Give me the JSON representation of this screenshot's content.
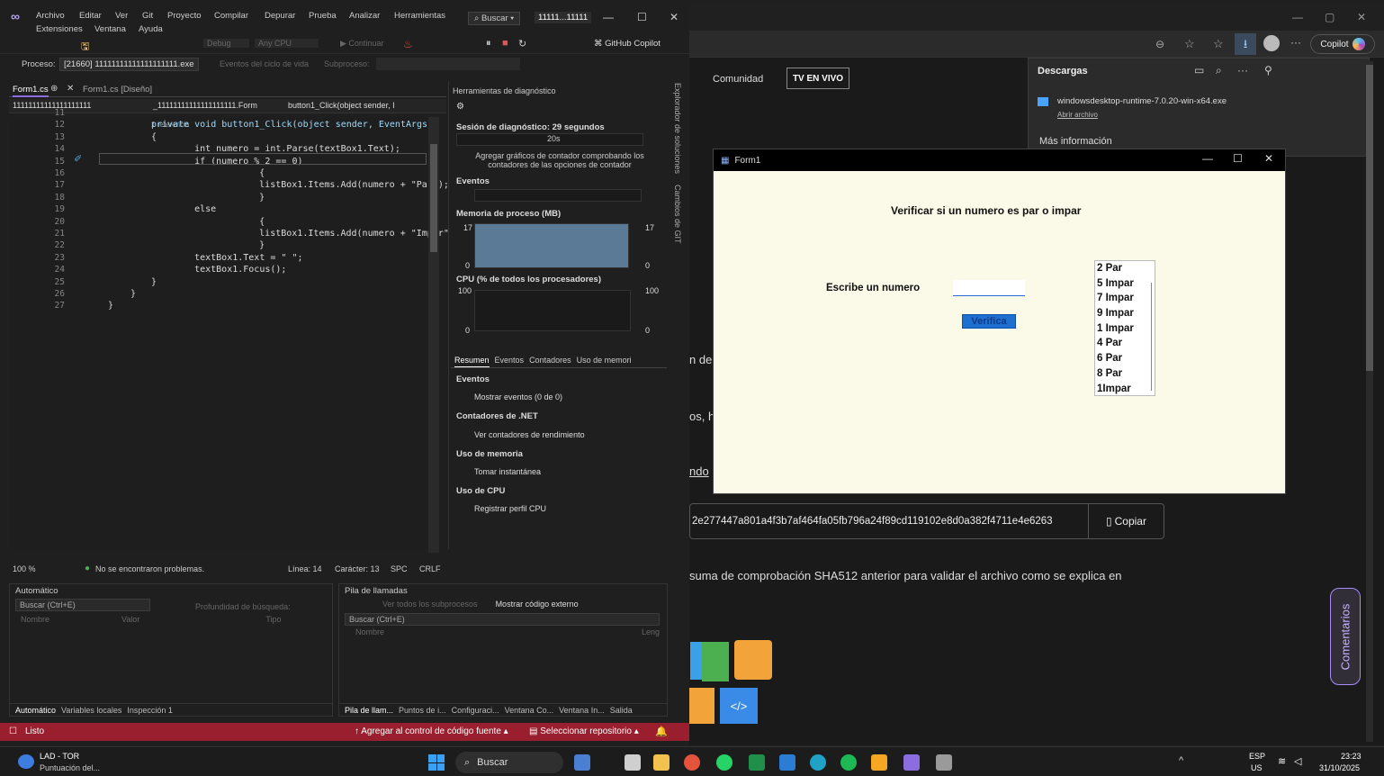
{
  "vs": {
    "menu": [
      "Archivo",
      "Editar",
      "Ver",
      "Git",
      "Proyecto",
      "Compilar",
      "Depurar",
      "Prueba",
      "Analizar",
      "Herramientas",
      "Extensiones",
      "Ventana",
      "Ayuda"
    ],
    "search": "Buscar",
    "project_title": "11111...11111",
    "toolbar": {
      "config": "Debug",
      "platform": "Any CPU",
      "continue": "Continuar",
      "copilot": "GitHub Copilot"
    },
    "proc": {
      "label": "Proceso:",
      "value": "[21660] 11111111111111111111.exe",
      "lifecycle": "Eventos del ciclo de vida",
      "thread": "Subproceso:"
    },
    "tabs": [
      "Form1.cs",
      "Form1.cs [Diseño]"
    ],
    "nav": {
      "left": "11111111111111111111",
      "mid": "_11111111111111111111.Form",
      "right": "button1_Click(object sender, I"
    },
    "refs": "1 referencia",
    "code_lines": [
      {
        "n": "11",
        "t": ""
      },
      {
        "n": "12",
        "t": "private void button1_Click(object sender, EventArgs"
      },
      {
        "n": "13",
        "t": "{"
      },
      {
        "n": "14",
        "t": "    int numero = int.Parse(textBox1.Text);"
      },
      {
        "n": "15",
        "t": "    if (numero % 2 == 0)"
      },
      {
        "n": "16",
        "t": "        {"
      },
      {
        "n": "17",
        "t": "        listBox1.Items.Add(numero + \"Par\");"
      },
      {
        "n": "18",
        "t": "        }"
      },
      {
        "n": "19",
        "t": "    else"
      },
      {
        "n": "20",
        "t": "        {"
      },
      {
        "n": "21",
        "t": "        listBox1.Items.Add(numero + \"Impar\");"
      },
      {
        "n": "22",
        "t": "        }"
      },
      {
        "n": "23",
        "t": "    textBox1.Text = \" \";"
      },
      {
        "n": "24",
        "t": "    textBox1.Focus();"
      },
      {
        "n": "25",
        "t": "}"
      },
      {
        "n": "26",
        "t": "}"
      },
      {
        "n": "27",
        "t": "}"
      }
    ],
    "editor_status": {
      "zoom": "100 %",
      "problems": "No se encontraron problemas.",
      "line": "Línea: 14",
      "col": "Carácter: 13",
      "spc": "SPC",
      "crlf": "CRLF"
    },
    "diag": {
      "title": "Herramientas de diagnóstico",
      "session": "Sesión de diagnóstico: 29 segundos",
      "timeline": "20s",
      "hint": "Agregar gráficos de contador comprobando los contadores de las opciones de contador",
      "events": "Eventos",
      "memory": "Memoria de proceso (MB)",
      "mem_max": "17",
      "mem_min": "0",
      "cpu": "CPU (% de todos los procesadores)",
      "cpu_max": "100",
      "cpu_min": "0",
      "tabs": [
        "Resumen",
        "Eventos",
        "Contadores",
        "Uso de memori"
      ],
      "sections": [
        {
          "h": "Eventos",
          "item": "Mostrar eventos (0 de 0)"
        },
        {
          "h": "Contadores de .NET",
          "item": "Ver contadores de rendimiento"
        },
        {
          "h": "Uso de memoria",
          "item": "Tomar instantánea"
        },
        {
          "h": "Uso de CPU",
          "item": "Registrar perfil CPU"
        }
      ]
    },
    "side_tabs": [
      "Explorador de soluciones",
      "Cambios de GIT"
    ],
    "auto": {
      "title": "Automático",
      "search": "Buscar (Ctrl+E)",
      "depth": "Profundidad de búsqueda:",
      "cols": [
        "Nombre",
        "Valor",
        "Tipo"
      ],
      "tabs": [
        "Automático",
        "Variables locales",
        "Inspección 1"
      ]
    },
    "stack": {
      "title": "Pila de llamadas",
      "threads": "Ver todos los subprocesos",
      "external": "Mostrar código externo",
      "search": "Buscar (Ctrl+E)",
      "cols": [
        "Nombre",
        "Leng"
      ],
      "tabs": [
        "Pila de llam...",
        "Puntos de i...",
        "Configuraci...",
        "Ventana Co...",
        "Ventana In...",
        "Salida"
      ]
    },
    "status": {
      "ready": "Listo",
      "git": "Agregar al control de código fuente",
      "repo": "Seleccionar repositorio"
    }
  },
  "browser": {
    "nav": [
      "Comunidad",
      "TV EN VIVO"
    ],
    "copilot": "Copilot",
    "downloads": {
      "title": "Descargas",
      "file": "windowsdesktop-runtime-7.0.20-win-x64.exe",
      "open": "Abrir archivo",
      "more": "Más información"
    },
    "fragments": [
      "n de",
      "os, h",
      "ndo"
    ],
    "hash": "2e277447a801a4f3b7af464fa05fb796a24f89cd119102e8d0a382f4711e4e6263",
    "copy": "Copiar",
    "sha_text": "suma de comprobación SHA512 anterior para validar el archivo como se explica en",
    "comentarios": "Comentarios"
  },
  "form1": {
    "title": "Form1",
    "heading": "Verificar si un numero es par o impar",
    "label": "Escribe un numero",
    "input_value": "",
    "button": "Verifica",
    "list": [
      "2 Par",
      "5 Impar",
      "7 Impar",
      "9 Impar",
      "1 Impar",
      "4 Par",
      "6 Par",
      "8 Par",
      "1Impar"
    ]
  },
  "taskbar": {
    "weather_title": "LAD - TOR",
    "weather_sub": "Puntuación del...",
    "search": "Buscar",
    "lang": "ESP",
    "region": "US",
    "time": "23:23",
    "date": "31/10/2025"
  },
  "colors": {
    "accent": "#1f6fd1",
    "status_red": "#9a1f2e",
    "vs_purple": "#8a6ee0"
  }
}
